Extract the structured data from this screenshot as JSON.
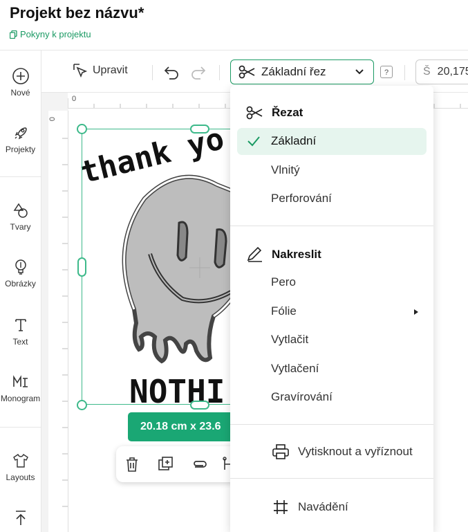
{
  "header": {
    "title": "Projekt bez názvu*",
    "link": "Pokyny k projektu"
  },
  "sidebar": {
    "items": [
      {
        "label": "Nové",
        "icon": "plus-circle-icon"
      },
      {
        "label": "Projekty",
        "icon": "rocket-icon"
      },
      {
        "label": "Tvary",
        "icon": "shapes-icon"
      },
      {
        "label": "Obrázky",
        "icon": "bulb-icon"
      },
      {
        "label": "Text",
        "icon": "text-icon"
      },
      {
        "label": "Monogram",
        "icon": "monogram-icon"
      },
      {
        "label": "Layouts",
        "icon": "shirt-icon"
      }
    ]
  },
  "toolbar": {
    "edit_label": "Upravit",
    "operation_label": "Základní řez",
    "help_label": "?",
    "width_prefix": "Š",
    "width_value": "20,175"
  },
  "canvas": {
    "ruler_top_zero": "0",
    "ruler_left_zero": "0",
    "design_text_top": "thank yo",
    "design_text_bottom": "NOTHI",
    "dimensions_label": "20.18  cm x 23.6"
  },
  "menu": {
    "cut_header": "Řezat",
    "cut_items": [
      "Základní",
      "Vlnitý",
      "Perforování"
    ],
    "selected_item": "Základní",
    "draw_header": "Nakreslit",
    "draw_items": [
      "Pero",
      "Fólie",
      "Vytlačit",
      "Vytlačení",
      "Gravírování"
    ],
    "print_cut": "Vytisknout a vyříznout",
    "guide": "Navádění"
  },
  "colors": {
    "accent": "#1a9a63",
    "badge": "#1aa774",
    "selection_bg": "#e6f5ee"
  }
}
